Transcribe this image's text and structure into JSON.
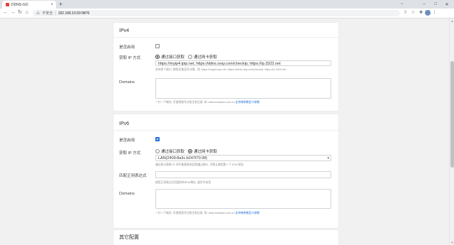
{
  "browser": {
    "tab_title": "DDNS-GO",
    "tab_close": "×",
    "new_tab": "+",
    "tab_menu": "⌄",
    "win_minimize": "–",
    "win_maximize": "□",
    "win_close": "✕",
    "address_warning": "⚠",
    "address_insecure": "不安全",
    "address_sep": "|",
    "address_url": "192.168.10.50:9876"
  },
  "ipv4": {
    "title": "IPv4",
    "enable_label": "是否启用",
    "enabled": false,
    "method_label": "获取 IP 方式",
    "method_options": [
      "通过接口获取",
      "通过网卡获取"
    ],
    "method_selected": 0,
    "url_value": "https://myip4.ipip.net, https://ddns.oray.com/checkip, https://ip.3322.net",
    "url_help": "支持多个接口, 使用半角逗号分隔。如: https://myip4.ipip.net, https://ddns.oray.com/checkip, https://ip.3322.net",
    "domains_label": "Domains",
    "domains_help_prefix": "一行一个域名, 可使用冒号分割主机记录. 如: ddns:example.com.cn",
    "domains_help_link": "支持带参数定义参数"
  },
  "ipv6": {
    "title": "IPv6",
    "enable_label": "是否启用",
    "enabled": true,
    "method_label": "获取 IP 方式",
    "method_options": [
      "通过接口获取",
      "通过网卡获取"
    ],
    "method_selected": 1,
    "select_value": "LAN(2409:8a3c:b247f70:38)",
    "select_help": "通过网卡获取 IP, 如不能获取则回到通过接口, 可默认使用第一个 IPv6 地址",
    "regex_label": "匹配正则表达式",
    "regex_value": "",
    "regex_help": "使用正则表达式匹配你的IPv6地址, 留空不启用",
    "domains_label": "Domains",
    "domains_help_prefix": "一行一个域名, 可使用冒号分割主机记录. 如: ddns:example.com.cn",
    "domains_help_link": "支持带参数定义参数"
  },
  "other": {
    "title": "其它配置"
  },
  "icons": {
    "back": "←",
    "forward": "→",
    "reload": "↻",
    "home": "⌂",
    "share": "⇧",
    "star": "☆",
    "extensions": "✚",
    "menu": "⋮"
  }
}
